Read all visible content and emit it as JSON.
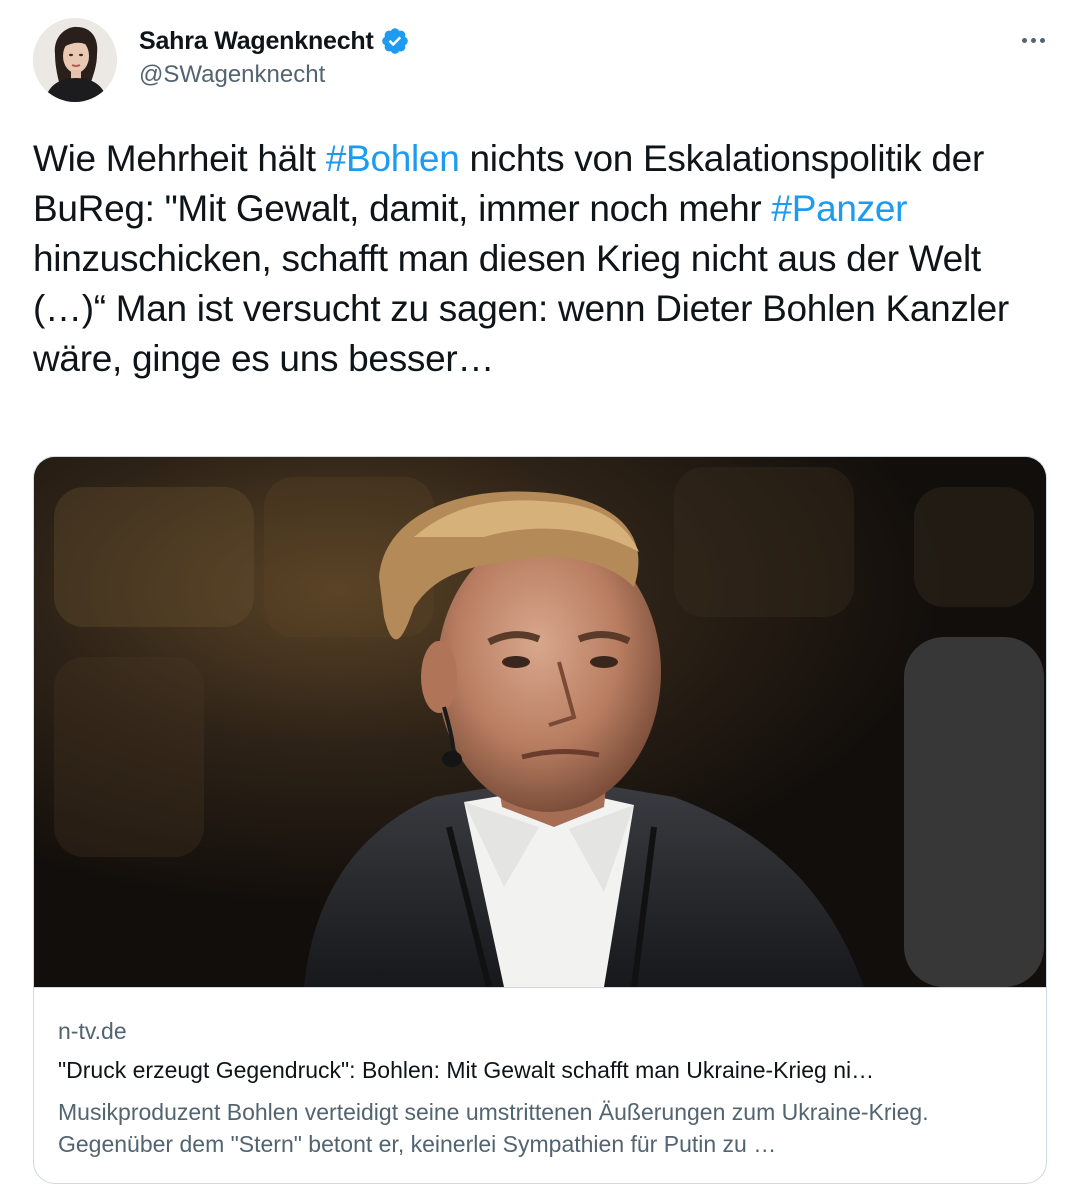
{
  "author": {
    "display_name": "Sahra Wagenknecht",
    "handle": "@SWagenknecht",
    "verified": true,
    "avatar_icon": "profile-photo"
  },
  "more_icon": "more-options-icon",
  "tweet": {
    "text_parts": [
      {
        "type": "text",
        "value": "Wie Mehrheit hält "
      },
      {
        "type": "hashtag",
        "value": "#Bohlen"
      },
      {
        "type": "text",
        "value": " nichts von Eskalationspolitik der BuReg: \"Mit Gewalt, damit, immer noch mehr "
      },
      {
        "type": "hashtag",
        "value": "#Panzer"
      },
      {
        "type": "text",
        "value": " hinzuschicken, schafft man diesen Krieg nicht aus der Welt (…)“ Man ist versucht zu sagen: wenn Dieter Bohlen Kanzler wäre, ginge es uns besser…"
      }
    ]
  },
  "card": {
    "domain": "n-tv.de",
    "title": "\"Druck erzeugt Gegendruck\": Bohlen: Mit Gewalt schafft man Ukraine-Krieg ni…",
    "description": "Musikproduzent Bohlen verteidigt seine umstrittenen Äußerungen zum Ukraine-Krieg. Gegenüber dem \"Stern\" betont er, keinerlei Sympathien für Putin zu …"
  },
  "colors": {
    "hashtag": "#1d9bf0",
    "verified": "#1d9bf0",
    "secondary_text": "#536471",
    "border": "#cfd9de"
  }
}
